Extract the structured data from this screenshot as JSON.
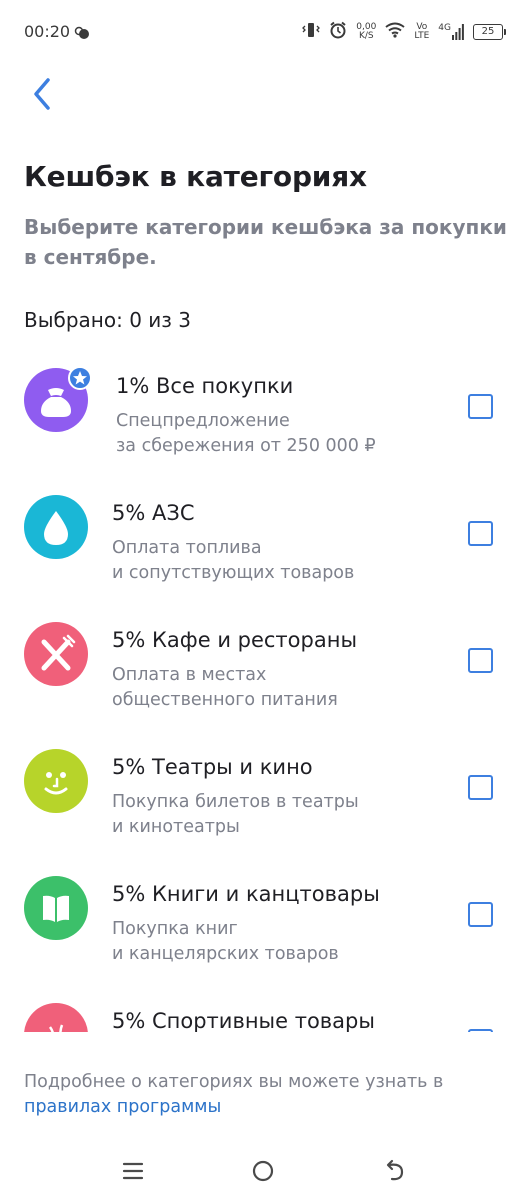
{
  "status_bar": {
    "time": "00:20",
    "net_speed_value": "0,00",
    "net_speed_unit": "K/S",
    "volte_top": "Vo",
    "volte_bottom": "LTE",
    "network": "4G",
    "battery": "25",
    "icons": [
      "weather-icon",
      "vibrate-icon",
      "alarm-icon",
      "wifi-icon",
      "signal-icon",
      "battery-icon"
    ]
  },
  "header": {
    "title": "Кешбэк в категориях",
    "subtitle": "Выберите категории кешбэка за покупки в сентябре."
  },
  "selection": {
    "label": "Выбрано: 0 из 3"
  },
  "categories": [
    {
      "title": "1% Все покупки",
      "desc_line1": "Спецпредложение",
      "desc_line2": "за сбережения от 250 000 ₽",
      "icon": "money-bag-icon",
      "color": "#8f5cf0",
      "badge": "star-badge-icon",
      "checked": false
    },
    {
      "title": "5% АЗС",
      "desc_line1": "Оплата топлива",
      "desc_line2": "и сопутствующих товаров",
      "icon": "drop-icon",
      "color": "#1ab7d6",
      "checked": false
    },
    {
      "title": "5% Кафе и рестораны",
      "desc_line1": "Оплата в местах",
      "desc_line2": "общественного питания",
      "icon": "fork-knife-icon",
      "color": "#f0607a",
      "checked": false
    },
    {
      "title": "5% Театры и кино",
      "desc_line1": "Покупка билетов в театры",
      "desc_line2": "и кинотеатры",
      "icon": "smile-face-icon",
      "color": "#b7d42a",
      "checked": false
    },
    {
      "title": "5% Книги и канцтовары",
      "desc_line1": "Покупка книг",
      "desc_line2": "и канцелярских товаров",
      "icon": "open-book-icon",
      "color": "#3cc06a",
      "checked": false
    },
    {
      "title": "5% Спортивные товары",
      "desc_line1": "",
      "desc_line2": "",
      "icon": "sport-ball-icon",
      "color": "#f0607a",
      "checked": false
    }
  ],
  "footer": {
    "text": "Подробнее о категориях вы можете узнать в",
    "link": "правилах программы"
  },
  "colors": {
    "accent": "#3d7fe0",
    "link": "#2c73c9",
    "secondary_text": "#7e818c"
  }
}
